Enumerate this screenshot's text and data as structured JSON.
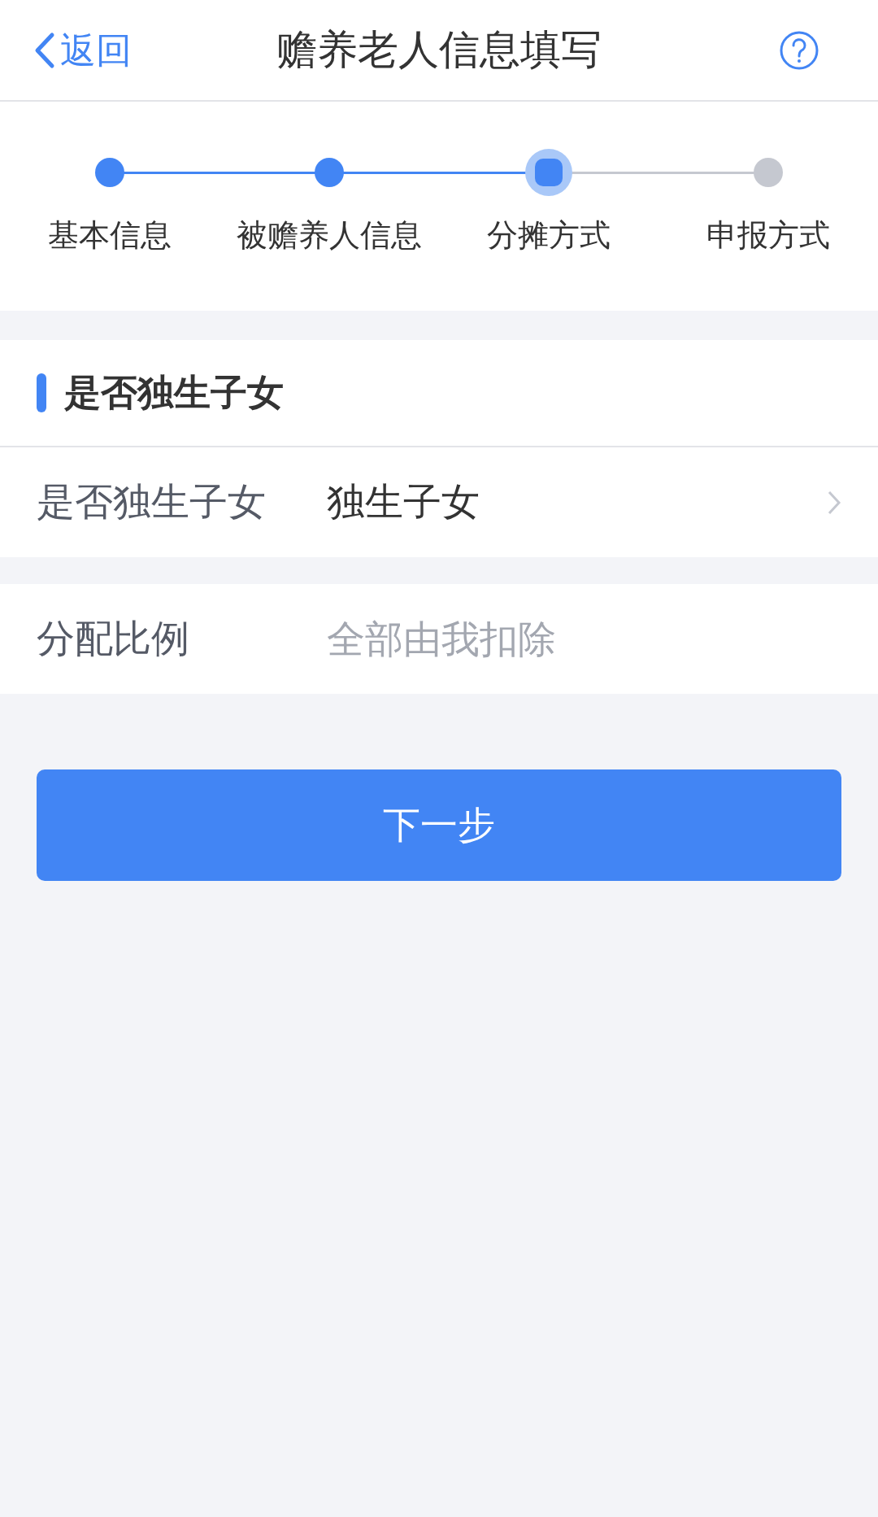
{
  "nav": {
    "back": "返回",
    "title": "赡养老人信息填写"
  },
  "steps": [
    {
      "kind": "done",
      "label": "基本信息"
    },
    {
      "kind": "done",
      "label": "被赡养人信息"
    },
    {
      "kind": "current",
      "label": "分摊方式"
    },
    {
      "kind": "pending",
      "label": "申报方式"
    }
  ],
  "section": {
    "title": "是否独生子女"
  },
  "rows": [
    {
      "kind": "select",
      "label": "是否独生子女",
      "value": "独生子女"
    },
    {
      "kind": "input",
      "label": "分配比例",
      "placeholder": "全部由我扣除"
    }
  ],
  "next_button": "下一步"
}
